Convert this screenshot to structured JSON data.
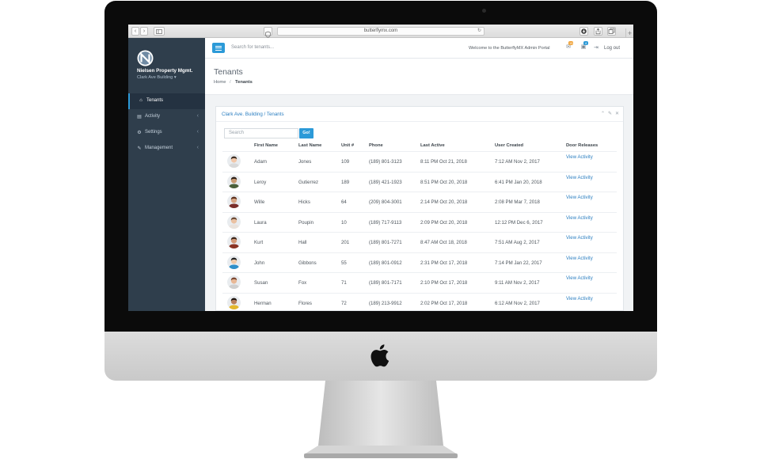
{
  "browser": {
    "url": "butterflymx.com",
    "back": "‹",
    "forward": "›",
    "plus": "+"
  },
  "sidebar": {
    "brand_name": "Nielsen Property Mgmt.",
    "brand_sub": "Clark Ave Building ▾",
    "items": [
      {
        "label": "Tenants",
        "icon": "home-icon",
        "glyph": "⌂",
        "active": true
      },
      {
        "label": "Activity",
        "icon": "list-icon",
        "glyph": "▤",
        "chevron": "‹"
      },
      {
        "label": "Settings",
        "icon": "gears-icon",
        "glyph": "⚙",
        "chevron": "‹"
      },
      {
        "label": "Management",
        "icon": "edit-icon",
        "glyph": "✎",
        "chevron": "‹"
      }
    ]
  },
  "topbar": {
    "search_placeholder": "Search for tenants...",
    "welcome": "Welcome to the ButterflyMX Admin Portal",
    "badge_one": "15",
    "badge_two": "4",
    "logout": "Log out",
    "colors": {
      "accent": "#2c9ad8",
      "badge_one": "#f0a236",
      "badge_two": "#2c9ad8"
    }
  },
  "page": {
    "title": "Tenants",
    "breadcrumb_home": "Home",
    "breadcrumb_sep": "/",
    "breadcrumb_current": "Tenants"
  },
  "panel": {
    "title": "Clark Ave. Building / Tenants",
    "search_placeholder": "Search",
    "go_label": "Go!",
    "headers": {
      "first_name": "First Name",
      "last_name": "Last Name",
      "unit": "Unit #",
      "phone": "Phone",
      "last_active": "Last Active",
      "user_created": "User Created",
      "door_releases": "Door Releases"
    },
    "rows": [
      {
        "first": "Adam",
        "last": "Jones",
        "unit": "109",
        "phone": "(189) 801-3123",
        "last_active": "8:11 PM Oct 21, 2018",
        "created": "7:12 AM Nov 2, 2017",
        "action": "View Activity",
        "skin": "#f1c7a9",
        "hair": "#3a2a1f",
        "shirt": "#d9d9d9"
      },
      {
        "first": "Leroy",
        "last": "Gutierrez",
        "unit": "189",
        "phone": "(189) 421-1923",
        "last_active": "8:51 PM Oct 20, 2018",
        "created": "6:41 PM Jan 20, 2018",
        "action": "View Activity",
        "skin": "#c99a72",
        "hair": "#2b1d14",
        "shirt": "#4a5f3a"
      },
      {
        "first": "Wille",
        "last": "Hicks",
        "unit": "64",
        "phone": "(209) 804-3001",
        "last_active": "2:14 PM Oct 20, 2018",
        "created": "2:08 PM Mar 7, 2018",
        "action": "View Activity",
        "skin": "#d8a684",
        "hair": "#5a2d1a",
        "shirt": "#7a2e2a"
      },
      {
        "first": "Laura",
        "last": "Poupin",
        "unit": "10",
        "phone": "(189) 717-9113",
        "last_active": "2:09 PM Oct 20, 2018",
        "created": "12:12 PM Dec 6, 2017",
        "action": "View Activity",
        "skin": "#eac1a2",
        "hair": "#6b4a34",
        "shirt": "#e9e2dc"
      },
      {
        "first": "Kurt",
        "last": "Hall",
        "unit": "201",
        "phone": "(189) 801-7271",
        "last_active": "8:47 AM Oct 18, 2018",
        "created": "7:51 AM Aug 2, 2017",
        "action": "View Activity",
        "skin": "#d49a78",
        "hair": "#3b2418",
        "shirt": "#8a3324"
      },
      {
        "first": "John",
        "last": "Gibbons",
        "unit": "55",
        "phone": "(189) 801-0912",
        "last_active": "2:31 PM Oct 17, 2018",
        "created": "7:14 PM Jan 22, 2017",
        "action": "View Activity",
        "skin": "#f0c9a8",
        "hair": "#1f1f1f",
        "shirt": "#2f8fc9"
      },
      {
        "first": "Susan",
        "last": "Fox",
        "unit": "71",
        "phone": "(189) 801-7171",
        "last_active": "2:10 PM Oct 17, 2018",
        "created": "9:11 AM Nov 2, 2017",
        "action": "View Activity",
        "skin": "#e8b896",
        "hair": "#7a4630",
        "shirt": "#cfcfcf"
      },
      {
        "first": "Herman",
        "last": "Flores",
        "unit": "72",
        "phone": "(189) 213-9912",
        "last_active": "2:02 PM Oct 17, 2018",
        "created": "6:12 AM Nov 2, 2017",
        "action": "View Activity",
        "skin": "#b97f5b",
        "hair": "#1c120c",
        "shirt": "#e4b72c"
      }
    ]
  }
}
